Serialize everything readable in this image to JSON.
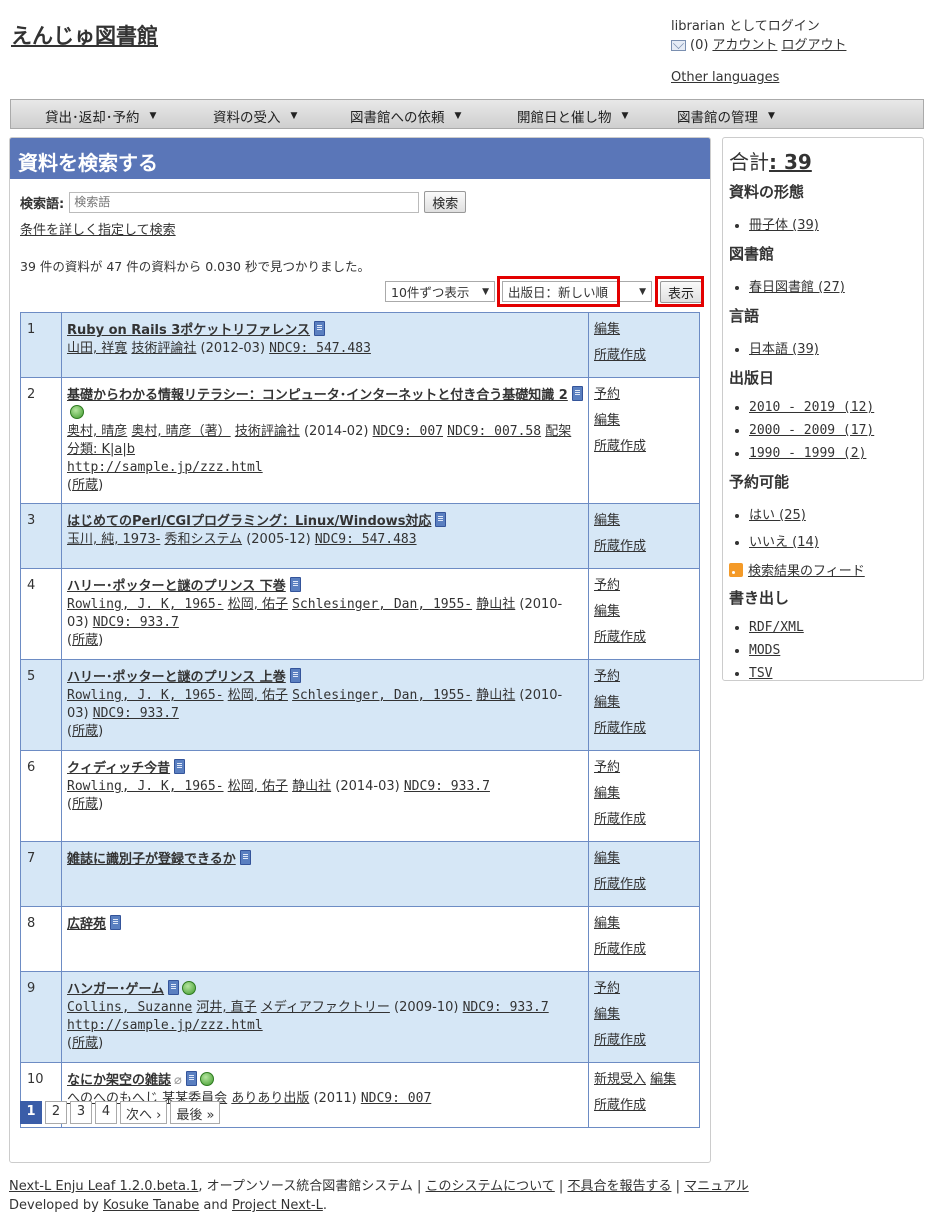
{
  "header": {
    "site_title": "えんじゅ図書館",
    "login_status": "librarian としてログイン",
    "mail_count": "(0)",
    "account_link": "アカウント",
    "logout_link": "ログアウト",
    "other_languages": "Other languages"
  },
  "nav": {
    "items": [
      {
        "label": "貸出･返却･予約"
      },
      {
        "label": "資料の受入"
      },
      {
        "label": "図書館への依頼"
      },
      {
        "label": "開館日と催し物"
      },
      {
        "label": "図書館の管理"
      }
    ]
  },
  "search": {
    "panel_title": "資料を検索する",
    "label": "検索語:",
    "placeholder": "検索語",
    "button": "検索",
    "advanced_link": "条件を詳しく指定して検索",
    "summary": "39 件の資料が 47 件の資料から 0.030 秒で見つかりました。"
  },
  "controls": {
    "per_page": "10件ずつ表示",
    "sort": "出版日：新しい順",
    "show_button": "表示"
  },
  "results": [
    {
      "num": "1",
      "title": "Ruby on Rails 3ポケットリファレンス",
      "globe": false,
      "clip": false,
      "meta": [
        {
          "t": "山田, 祥寛",
          "link": true
        },
        {
          "t": " ",
          "link": false
        },
        {
          "t": "技術評論社",
          "link": true
        },
        {
          "t": " (2012-03) ",
          "link": false
        },
        {
          "t": "NDC9: 547.483",
          "link": true
        }
      ],
      "url": "",
      "holding": "",
      "actions": [
        [
          "編集"
        ],
        [
          "所蔵作成"
        ]
      ]
    },
    {
      "num": "2",
      "title": "基礎からわかる情報リテラシー：コンピュータ･インターネットと付き合う基礎知識 2",
      "globe": true,
      "clip": false,
      "meta": [
        {
          "t": "奥村, 晴彦",
          "link": true
        },
        {
          "t": " ",
          "link": false
        },
        {
          "t": "奥村, 晴彦（著）",
          "link": true
        },
        {
          "t": " ",
          "link": false
        },
        {
          "t": "技術評論社",
          "link": true
        },
        {
          "t": " (2014-02) ",
          "link": false
        },
        {
          "t": "NDC9: 007",
          "link": true
        },
        {
          "t": " ",
          "link": false
        },
        {
          "t": "NDC9: 007.58",
          "link": true
        },
        {
          "t": " ",
          "link": false
        },
        {
          "t": "配架分類: K|a|b",
          "link": true
        }
      ],
      "url": "http://sample.jp/zzz.html",
      "holding": "所蔵",
      "actions": [
        [
          "予約"
        ],
        [
          "編集"
        ],
        [
          "所蔵作成"
        ]
      ]
    },
    {
      "num": "3",
      "title": "はじめてのPerl/CGIプログラミング：Linux/Windows対応",
      "globe": false,
      "clip": false,
      "meta": [
        {
          "t": "玉川, 純, 1973-",
          "link": true
        },
        {
          "t": " ",
          "link": false
        },
        {
          "t": "秀和システム",
          "link": true
        },
        {
          "t": " (2005-12) ",
          "link": false
        },
        {
          "t": "NDC9: 547.483",
          "link": true
        }
      ],
      "url": "",
      "holding": "",
      "actions": [
        [
          "編集"
        ],
        [
          "所蔵作成"
        ]
      ]
    },
    {
      "num": "4",
      "title": "ハリー･ポッターと謎のプリンス 下巻",
      "globe": false,
      "clip": false,
      "meta": [
        {
          "t": "Rowling, J. K, 1965-",
          "link": true
        },
        {
          "t": " ",
          "link": false
        },
        {
          "t": "松岡, 佑子",
          "link": true
        },
        {
          "t": " ",
          "link": false
        },
        {
          "t": "Schlesinger, Dan, 1955-",
          "link": true
        },
        {
          "t": " ",
          "link": false
        },
        {
          "t": "静山社",
          "link": true
        },
        {
          "t": " (2010-03) ",
          "link": false
        },
        {
          "t": "NDC9: 933.7",
          "link": true
        }
      ],
      "url": "",
      "holding": "所蔵",
      "actions": [
        [
          "予約"
        ],
        [
          "編集"
        ],
        [
          "所蔵作成"
        ]
      ]
    },
    {
      "num": "5",
      "title": "ハリー･ポッターと謎のプリンス 上巻",
      "globe": false,
      "clip": false,
      "meta": [
        {
          "t": "Rowling, J. K, 1965-",
          "link": true
        },
        {
          "t": " ",
          "link": false
        },
        {
          "t": "松岡, 佑子",
          "link": true
        },
        {
          "t": " ",
          "link": false
        },
        {
          "t": "Schlesinger, Dan, 1955-",
          "link": true
        },
        {
          "t": " ",
          "link": false
        },
        {
          "t": "静山社",
          "link": true
        },
        {
          "t": " (2010-03) ",
          "link": false
        },
        {
          "t": "NDC9: 933.7",
          "link": true
        }
      ],
      "url": "",
      "holding": "所蔵",
      "actions": [
        [
          "予約"
        ],
        [
          "編集"
        ],
        [
          "所蔵作成"
        ]
      ]
    },
    {
      "num": "6",
      "title": "クィディッチ今昔",
      "globe": false,
      "clip": false,
      "meta": [
        {
          "t": "Rowling, J. K, 1965-",
          "link": true
        },
        {
          "t": " ",
          "link": false
        },
        {
          "t": "松岡, 佑子",
          "link": true
        },
        {
          "t": " ",
          "link": false
        },
        {
          "t": "静山社",
          "link": true
        },
        {
          "t": " (2014-03) ",
          "link": false
        },
        {
          "t": "NDC9: 933.7",
          "link": true
        }
      ],
      "url": "",
      "holding": "所蔵",
      "actions": [
        [
          "予約"
        ],
        [
          "編集"
        ],
        [
          "所蔵作成"
        ]
      ]
    },
    {
      "num": "7",
      "title": "雑誌に識別子が登録できるか",
      "globe": false,
      "clip": false,
      "meta": [],
      "url": "",
      "holding": "",
      "actions": [
        [
          "編集"
        ],
        [
          "所蔵作成"
        ]
      ]
    },
    {
      "num": "8",
      "title": "広辞苑",
      "globe": false,
      "clip": false,
      "meta": [],
      "url": "",
      "holding": "",
      "actions": [
        [
          "編集"
        ],
        [
          "所蔵作成"
        ]
      ]
    },
    {
      "num": "9",
      "title": "ハンガー･ゲーム",
      "globe": true,
      "clip": false,
      "meta": [
        {
          "t": "Collins, Suzanne",
          "link": true
        },
        {
          "t": " ",
          "link": false
        },
        {
          "t": "河井, 直子",
          "link": true
        },
        {
          "t": " ",
          "link": false
        },
        {
          "t": "メディアファクトリー",
          "link": true
        },
        {
          "t": " (2009-10) ",
          "link": false
        },
        {
          "t": "NDC9: 933.7",
          "link": true
        }
      ],
      "url": "http://sample.jp/zzz.html",
      "holding": "所蔵",
      "actions": [
        [
          "予約"
        ],
        [
          "編集"
        ],
        [
          "所蔵作成"
        ]
      ]
    },
    {
      "num": "10",
      "title": "なにか架空の雑誌",
      "globe": true,
      "clip": true,
      "meta": [
        {
          "t": "へのへのもへじ",
          "link": true
        },
        {
          "t": " ",
          "link": false
        },
        {
          "t": "某某委員会",
          "link": true
        },
        {
          "t": " ",
          "link": false
        },
        {
          "t": "ありあり出版",
          "link": true
        },
        {
          "t": " (2011) ",
          "link": false
        },
        {
          "t": "NDC9: 007",
          "link": true
        }
      ],
      "url": "",
      "holding": "",
      "actions": [
        [
          "新規受入",
          "編集"
        ],
        [
          "所蔵作成"
        ]
      ]
    }
  ],
  "pagination": {
    "pages": [
      "1",
      "2",
      "3",
      "4"
    ],
    "next": "次へ ›",
    "last": "最後 »"
  },
  "sidebar": {
    "total_label": "合計",
    "total_value": ": 39",
    "facets": [
      {
        "heading": "資料の形態",
        "items": [
          "冊子体 (39)"
        ]
      },
      {
        "heading": "図書館",
        "items": [
          "春日図書館 (27)"
        ]
      },
      {
        "heading": "言語",
        "items": [
          "日本語 (39)"
        ]
      },
      {
        "heading": "出版日",
        "items": [
          "2010 - 2019 (12)",
          "2000 - 2009 (17)",
          "1990 - 1999 (2)"
        ]
      },
      {
        "heading": "予約可能",
        "items": [
          "はい (25)",
          "いいえ (14)"
        ]
      }
    ],
    "feed_link": "検索結果のフィード",
    "export_heading": "書き出し",
    "export_items": [
      "RDF/XML",
      "MODS",
      "TSV"
    ]
  },
  "footer": {
    "product_link": "Next-L Enju Leaf 1.2.0.beta.1",
    "product_desc": ", オープンソース統合図書館システム",
    "sep": "|",
    "about_link": "このシステムについて",
    "bug_link": "不具合を報告する",
    "manual_link": "マニュアル",
    "developed_by": "Developed by",
    "author_link": "Kosuke Tanabe",
    "and": "and",
    "project_link": "Project Next-L",
    "period": "."
  },
  "colors": {
    "title_bar": "#5a76b8",
    "row_shade": "#d6e7f6",
    "highlight_frame": "#e30000"
  }
}
